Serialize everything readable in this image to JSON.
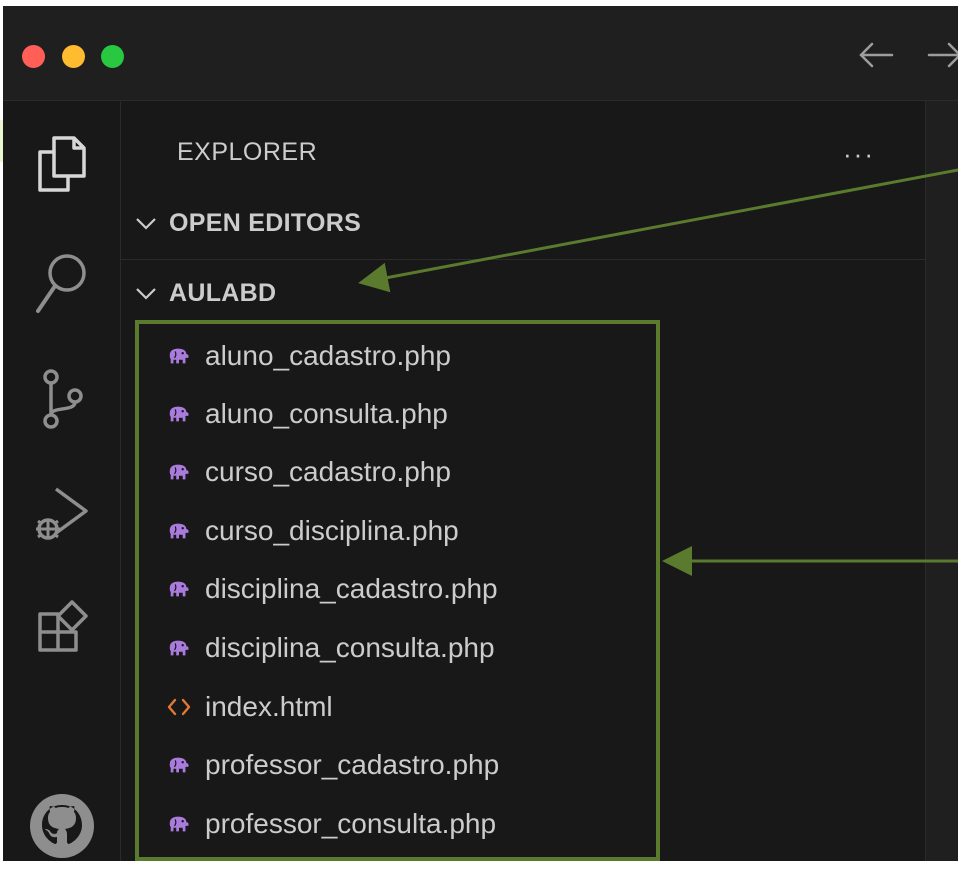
{
  "titlebar": {
    "back_icon": "arrow-left-icon",
    "forward_icon": "arrow-right-icon"
  },
  "activity_bar": {
    "items": [
      {
        "name": "explorer",
        "icon": "files-icon"
      },
      {
        "name": "search",
        "icon": "search-icon"
      },
      {
        "name": "source-control",
        "icon": "source-control-icon"
      },
      {
        "name": "run-debug",
        "icon": "run-debug-icon"
      },
      {
        "name": "extensions",
        "icon": "extensions-icon"
      },
      {
        "name": "github",
        "icon": "github-icon"
      }
    ]
  },
  "sidebar": {
    "title": "EXPLORER",
    "more_label": "···",
    "open_editors_label": "OPEN EDITORS",
    "folder_label": "AULABD",
    "files": [
      {
        "name": "aluno_cadastro.php",
        "type": "php"
      },
      {
        "name": "aluno_consulta.php",
        "type": "php"
      },
      {
        "name": "curso_cadastro.php",
        "type": "php"
      },
      {
        "name": "curso_disciplina.php",
        "type": "php"
      },
      {
        "name": "disciplina_cadastro.php",
        "type": "php"
      },
      {
        "name": "disciplina_consulta.php",
        "type": "php"
      },
      {
        "name": "index.html",
        "type": "html"
      },
      {
        "name": "professor_cadastro.php",
        "type": "php"
      },
      {
        "name": "professor_consulta.php",
        "type": "php"
      }
    ]
  },
  "colors": {
    "background": "#181818",
    "text": "#cccccc",
    "php_icon": "#a97bdc",
    "html_icon": "#e37933",
    "annotation": "#5a7a2e"
  }
}
